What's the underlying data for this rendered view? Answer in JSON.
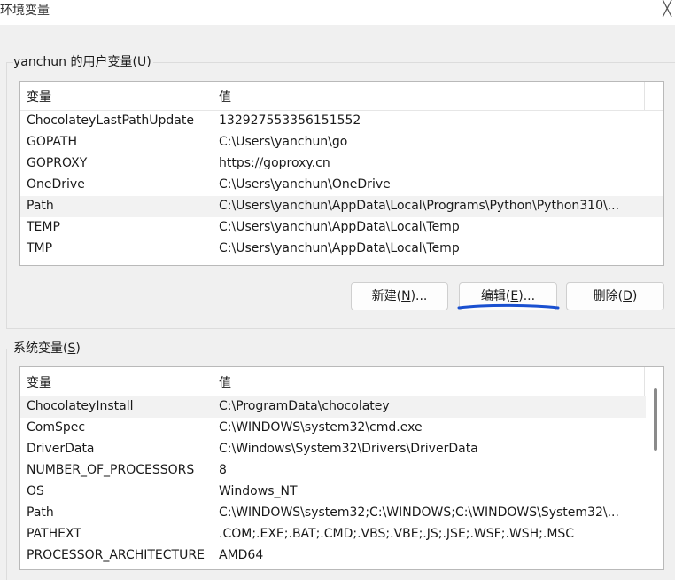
{
  "window": {
    "title": "环境变量",
    "close_glyph": "╳"
  },
  "user_group": {
    "legend_prefix": "yanchun 的用户变量(",
    "legend_key": "U",
    "legend_suffix": ")",
    "header": {
      "name": "变量",
      "value": "值"
    },
    "rows": [
      {
        "name": "ChocolateyLastPathUpdate",
        "value": "132927553356151552"
      },
      {
        "name": "GOPATH",
        "value": "C:\\Users\\yanchun\\go"
      },
      {
        "name": "GOPROXY",
        "value": "https://goproxy.cn"
      },
      {
        "name": "OneDrive",
        "value": "C:\\Users\\yanchun\\OneDrive"
      },
      {
        "name": "Path",
        "value": "C:\\Users\\yanchun\\AppData\\Local\\Programs\\Python\\Python310\\..."
      },
      {
        "name": "TEMP",
        "value": "C:\\Users\\yanchun\\AppData\\Local\\Temp"
      },
      {
        "name": "TMP",
        "value": "C:\\Users\\yanchun\\AppData\\Local\\Temp"
      }
    ],
    "buttons": {
      "new": {
        "prefix": "新建(",
        "key": "N",
        "suffix": ")..."
      },
      "edit": {
        "prefix": "编辑(",
        "key": "E",
        "suffix": ")..."
      },
      "delete": {
        "prefix": "删除(",
        "key": "D",
        "suffix": ")"
      }
    }
  },
  "system_group": {
    "legend_prefix": "系统变量(",
    "legend_key": "S",
    "legend_suffix": ")",
    "header": {
      "name": "变量",
      "value": "值"
    },
    "rows": [
      {
        "name": "ChocolateyInstall",
        "value": "C:\\ProgramData\\chocolatey"
      },
      {
        "name": "ComSpec",
        "value": "C:\\WINDOWS\\system32\\cmd.exe"
      },
      {
        "name": "DriverData",
        "value": "C:\\Windows\\System32\\Drivers\\DriverData"
      },
      {
        "name": "NUMBER_OF_PROCESSORS",
        "value": "8"
      },
      {
        "name": "OS",
        "value": "Windows_NT"
      },
      {
        "name": "Path",
        "value": "C:\\WINDOWS\\system32;C:\\WINDOWS;C:\\WINDOWS\\System32\\..."
      },
      {
        "name": "PATHEXT",
        "value": ".COM;.EXE;.BAT;.CMD;.VBS;.VBE;.JS;.JSE;.WSF;.WSH;.MSC"
      },
      {
        "name": "PROCESSOR_ARCHITECTURE",
        "value": "AMD64"
      }
    ]
  },
  "annotation": {
    "color": "#1a50d0"
  }
}
